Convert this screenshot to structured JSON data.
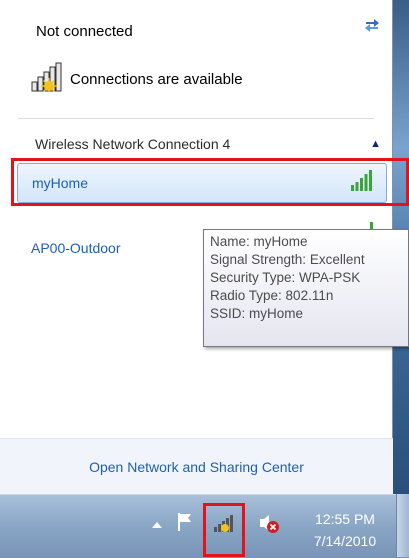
{
  "header": {
    "title": "Not connected",
    "status_text": "Connections are available"
  },
  "section": {
    "label": "Wireless Network Connection 4"
  },
  "networks": [
    {
      "name": "myHome",
      "selected": true
    },
    {
      "name": "AP00-Outdoor",
      "selected": false
    }
  ],
  "tooltip": {
    "lines": [
      "Name: myHome",
      "Signal Strength: Excellent",
      "Security Type: WPA-PSK",
      "Radio Type: 802.11n",
      "SSID: myHome"
    ]
  },
  "footer": {
    "link_label": "Open Network and Sharing Center"
  },
  "taskbar": {
    "time": "12:55 PM",
    "date": "7/14/2010",
    "icons": [
      "show-hidden-icons-arrow-icon",
      "action-center-flag-icon",
      "network-signal-icon",
      "volume-muted-icon"
    ]
  },
  "colors": {
    "link": "#1e5fb4",
    "highlight": "#e1141c",
    "selected_bg": "#d3e6fa",
    "signal_green": "#3aa63a",
    "taskbar": "#8aa6c6"
  }
}
